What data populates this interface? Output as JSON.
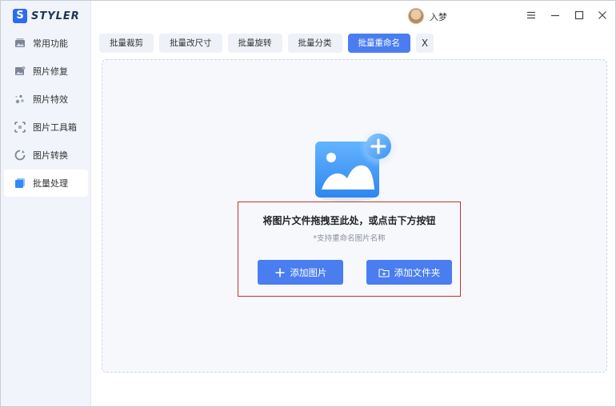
{
  "app": {
    "logo_mark": "S",
    "logo_text": "STYLER"
  },
  "sidebar": {
    "items": [
      {
        "label": "常用功能",
        "icon": "image-stack-icon"
      },
      {
        "label": "照片修复",
        "icon": "photo-repair-icon"
      },
      {
        "label": "照片特效",
        "icon": "sparkle-icon"
      },
      {
        "label": "图片工具箱",
        "icon": "toolbox-crop-icon"
      },
      {
        "label": "图片转换",
        "icon": "convert-icon"
      },
      {
        "label": "批量处理",
        "icon": "batch-icon",
        "active": true
      }
    ]
  },
  "titlebar": {
    "username": "入梦"
  },
  "tabs": [
    {
      "label": "批量裁剪"
    },
    {
      "label": "批量改尺寸"
    },
    {
      "label": "批量旋转"
    },
    {
      "label": "批量分类"
    },
    {
      "label": "批量重命名",
      "active": true
    }
  ],
  "tab_close_label": "X",
  "dropzone": {
    "title": "将图片文件拖拽至此处，或点击下方按钮",
    "subtitle": "*支持重命名图片名称",
    "add_image_label": "添加图片",
    "add_folder_label": "添加文件夹"
  },
  "colors": {
    "accent": "#4a7ef0",
    "sidebar_bg": "#f1f4fa",
    "highlight_box": "#c8322d"
  }
}
